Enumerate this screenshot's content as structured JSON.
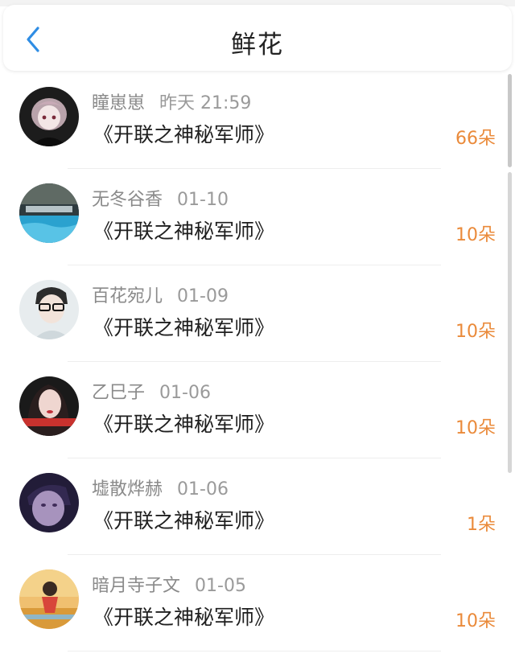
{
  "header": {
    "title": "鲜花",
    "back_icon": "chevron-left-icon"
  },
  "colors": {
    "accent": "#2f8de4",
    "count": "#ea8a3a"
  },
  "items": [
    {
      "user": "瞳崽崽",
      "date": "昨天 21:59",
      "book": "《开联之神秘军师》",
      "count": "66朵"
    },
    {
      "user": "无冬谷香",
      "date": "01-10",
      "book": "《开联之神秘军师》",
      "count": "10朵"
    },
    {
      "user": "百花宛儿",
      "date": "01-09",
      "book": "《开联之神秘军师》",
      "count": "10朵"
    },
    {
      "user": "乙巳子",
      "date": "01-06",
      "book": "《开联之神秘军师》",
      "count": "10朵"
    },
    {
      "user": "墟散烨赫",
      "date": "01-06",
      "book": "《开联之神秘军师》",
      "count": "1朵"
    },
    {
      "user": "暗月寺子文",
      "date": "01-05",
      "book": "《开联之神秘军师》",
      "count": "10朵"
    }
  ]
}
